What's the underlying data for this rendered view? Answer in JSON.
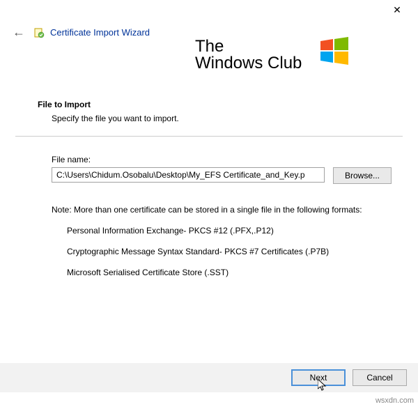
{
  "window": {
    "title": "Certificate Import Wizard"
  },
  "watermark": {
    "line1": "The",
    "line2": "Windows Club"
  },
  "page": {
    "heading": "File to Import",
    "subheading": "Specify the file you want to import."
  },
  "file": {
    "label": "File name:",
    "value": "C:\\Users\\Chidum.Osobalu\\Desktop\\My_EFS Certificate_and_Key.p",
    "browse_label": "Browse..."
  },
  "note": {
    "intro": "Note:  More than one certificate can be stored in a single file in the following formats:",
    "items": [
      "Personal Information Exchange- PKCS #12 (.PFX,.P12)",
      "Cryptographic Message Syntax Standard- PKCS #7 Certificates (.P7B)",
      "Microsoft Serialised Certificate Store (.SST)"
    ]
  },
  "buttons": {
    "next": "Next",
    "cancel": "Cancel"
  },
  "footer": {
    "site": "wsxdn.com"
  }
}
